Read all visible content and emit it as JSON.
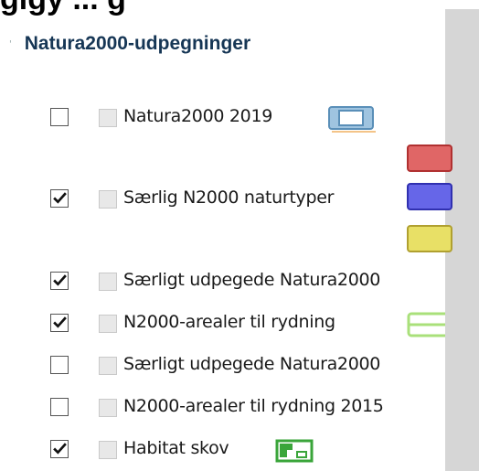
{
  "header": {
    "partial_title": "gigy ... g"
  },
  "group": {
    "title": "Natura2000-udpegninger",
    "toggle_glyph": "'"
  },
  "layers": [
    {
      "label": "Natura2000 2019",
      "checked": false,
      "legend_icon": "map-frame-icon"
    },
    {
      "label": "Særlig N2000 naturtyper",
      "checked": true,
      "legend_colors": [
        "#e06666",
        "#6666e8",
        "#e8e066"
      ]
    },
    {
      "label": "Særligt udpegede Natura2000",
      "checked": true
    },
    {
      "label": "N2000-arealer til rydning",
      "checked": true,
      "legend_colors": [
        "#a9e07a"
      ]
    },
    {
      "label": "Særligt udpegede Natura2000",
      "checked": false
    },
    {
      "label": "N2000-arealer til rydning 2015",
      "checked": false
    },
    {
      "label": "Habitat skov",
      "checked": true,
      "legend_icon": "forest-area-icon"
    }
  ]
}
